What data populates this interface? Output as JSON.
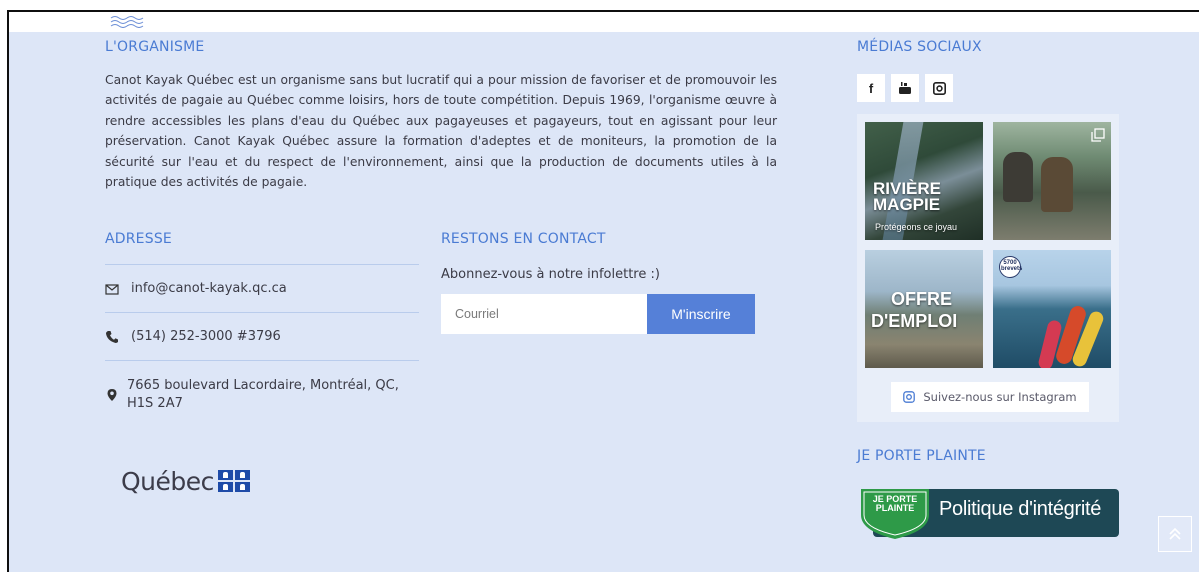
{
  "organisme": {
    "heading": "L'ORGANISME",
    "paragraph": "Canot Kayak Québec est un organisme sans but lucratif qui a pour mission de favoriser et de promouvoir les activités de pagaie au Québec comme loisirs, hors de toute compétition. Depuis 1969, l'organisme œuvre à rendre accessibles les plans d'eau du Québec aux pagayeuses et pagayeurs, tout en agissant pour leur préservation. Canot Kayak Québec assure la formation d'adeptes et de moniteurs, la promotion de la sécurité sur l'eau et du respect de l'environnement, ainsi que la production de documents utiles à la pratique des activités de pagaie."
  },
  "adresse": {
    "heading": "ADRESSE",
    "email": "info@canot-kayak.qc.ca",
    "phone": "(514) 252-3000 #3796",
    "address_line1": "7665 boulevard Lacordaire, Montréal, QC,",
    "address_line2": "H1S 2A7"
  },
  "quebec_logo": {
    "word": "Québec"
  },
  "contact": {
    "heading": "RESTONS EN CONTACT",
    "newsletter_text": "Abonnez-vous à notre infolettre :)",
    "email_placeholder": "Courriel",
    "subscribe_label": "M'inscrire"
  },
  "social": {
    "heading": "MÉDIAS SOCIAUX",
    "icons": [
      "facebook-icon",
      "youtube-icon",
      "instagram-icon"
    ],
    "posts": [
      {
        "line1": "RIVIÈRE",
        "line2": "MAGPIE",
        "sub": "Protégeons ce joyau"
      },
      {
        "line1": "",
        "line2": "",
        "sub": ""
      },
      {
        "line1": "OFFRE",
        "line2": "D'EMPLOI",
        "sub": ""
      },
      {
        "line1": "5700",
        "line2": "brevets",
        "sub": ""
      }
    ],
    "follow_label": "Suivez-nous sur Instagram"
  },
  "plainte": {
    "heading": "JE PORTE PLAINTE",
    "badge_line1": "JE PORTE",
    "badge_line2": "PLAINTE",
    "policy_title": "Politique d'intégrité"
  },
  "colors": {
    "accent": "#4a7bd3",
    "background": "#dde6f7",
    "button": "#5580d8",
    "badge_green": "#2e9a48",
    "badge_dark": "#1e4855"
  }
}
